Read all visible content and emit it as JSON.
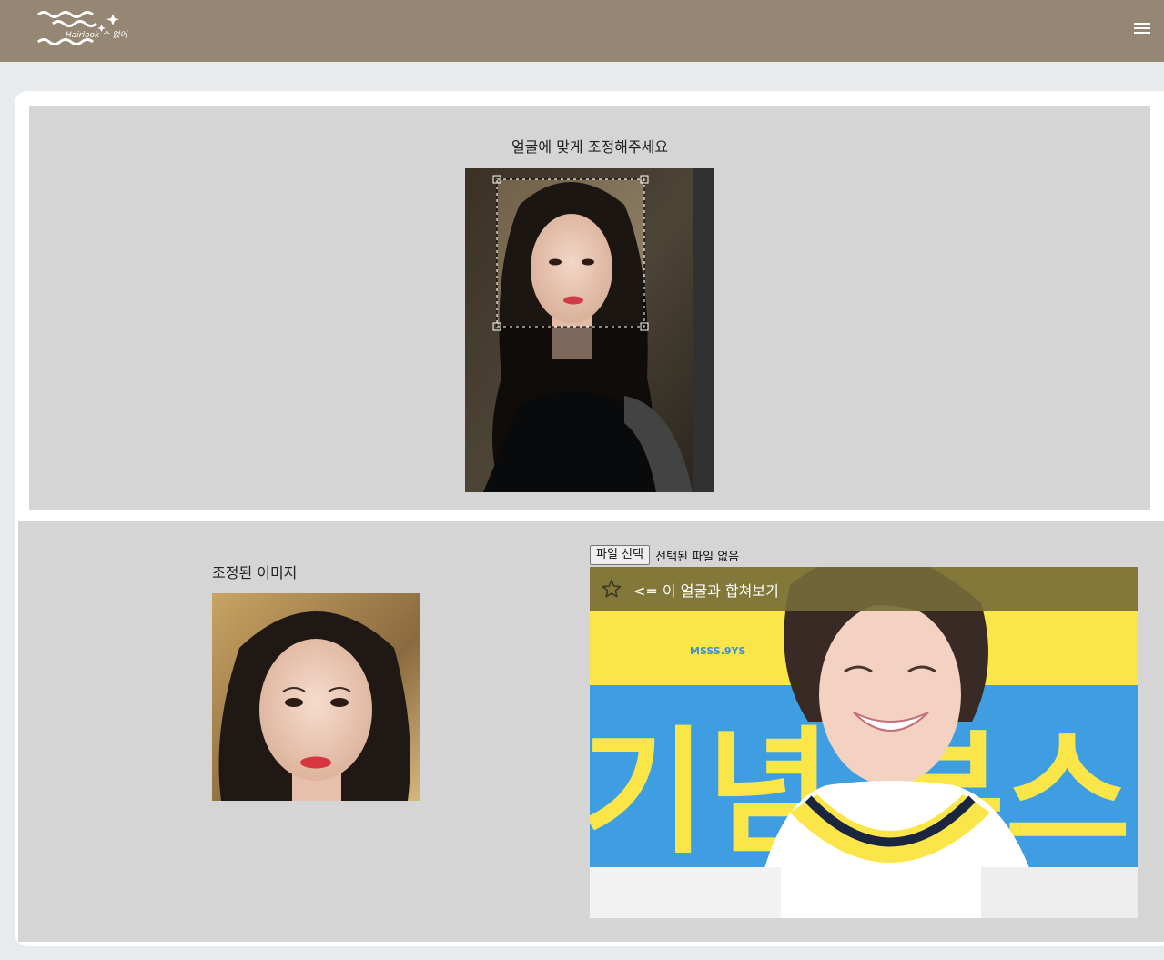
{
  "header": {
    "logo_text": "Hairlook 수 없어",
    "menu_icon": "hamburger-menu-icon",
    "bar_color": "#968774"
  },
  "crop": {
    "title": "얼굴에 맞게 조정해주세요"
  },
  "result": {
    "title": "조정된 이미지"
  },
  "upload": {
    "button_label": "파일 선택",
    "status": "선택된 파일 없음"
  },
  "target": {
    "banner_text": "<= 이 얼굴과 합쳐보기",
    "star_icon": "star-outline-icon",
    "bg_sign_text": "MSSS.9YS",
    "bg_sign_letters": "기념 부스"
  },
  "colors": {
    "panel_bg": "#d5d5d5",
    "page_bg": "#e8ebee",
    "banner_bg": "#766c38"
  }
}
